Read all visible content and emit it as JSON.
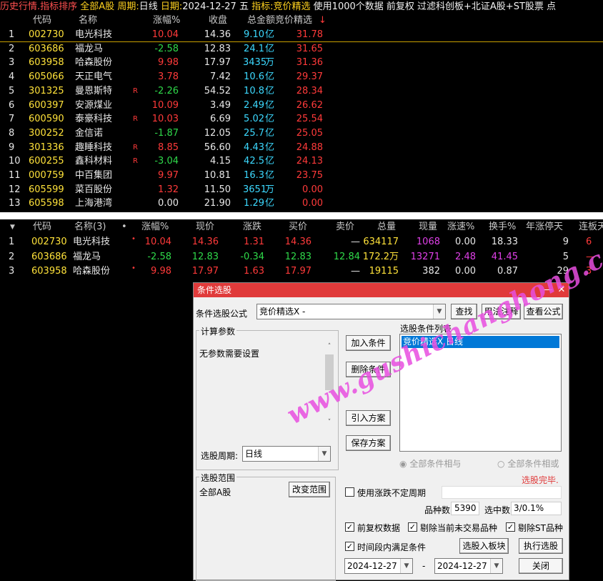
{
  "topbar": {
    "title": "历史行情.指标排序",
    "market": "全部A股",
    "period_label": "周期:",
    "period": "日线",
    "date_label": "日期:",
    "date": "2024-12-27",
    "weekday": "五",
    "indicator_label": "指标:",
    "indicator": "竞价精选",
    "note": "使用1000个数据 前复权 过滤科创板+北证A股+ST股票 点"
  },
  "table1": {
    "headers": {
      "code": "代码",
      "name": "名称",
      "pct": "涨幅%",
      "close": "收盘",
      "amount": "总金额",
      "score": "竞价精选",
      "sort": "↓"
    },
    "rows": [
      {
        "idx": "1",
        "code": "002730",
        "name": "电光科技",
        "flag": "",
        "pct": "10.04",
        "close": "14.36",
        "amount": "9.10",
        "unit": "亿",
        "score": "31.78",
        "pc": "red",
        "hl": true
      },
      {
        "idx": "2",
        "code": "603686",
        "name": "福龙马",
        "flag": "",
        "pct": "-2.58",
        "close": "12.83",
        "amount": "24.1",
        "unit": "亿",
        "score": "31.65",
        "pc": "grn"
      },
      {
        "idx": "3",
        "code": "603958",
        "name": "哈森股份",
        "flag": "",
        "pct": "9.98",
        "close": "17.97",
        "amount": "3435",
        "unit": "万",
        "score": "31.36",
        "pc": "red"
      },
      {
        "idx": "4",
        "code": "605066",
        "name": "天正电气",
        "flag": "",
        "pct": "3.78",
        "close": "7.42",
        "amount": "10.6",
        "unit": "亿",
        "score": "29.37",
        "pc": "red"
      },
      {
        "idx": "5",
        "code": "301325",
        "name": "曼恩斯特",
        "flag": "R",
        "pct": "-2.26",
        "close": "54.52",
        "amount": "10.8",
        "unit": "亿",
        "score": "28.34",
        "pc": "grn"
      },
      {
        "idx": "6",
        "code": "600397",
        "name": "安源煤业",
        "flag": "",
        "pct": "10.09",
        "close": "3.49",
        "amount": "2.49",
        "unit": "亿",
        "score": "26.62",
        "pc": "red"
      },
      {
        "idx": "7",
        "code": "600590",
        "name": "泰豪科技",
        "flag": "R",
        "pct": "10.03",
        "close": "6.69",
        "amount": "5.02",
        "unit": "亿",
        "score": "25.54",
        "pc": "red"
      },
      {
        "idx": "8",
        "code": "300252",
        "name": "金信诺",
        "flag": "",
        "pct": "-1.87",
        "close": "12.05",
        "amount": "25.7",
        "unit": "亿",
        "score": "25.05",
        "pc": "grn"
      },
      {
        "idx": "9",
        "code": "301336",
        "name": "趣睡科技",
        "flag": "R",
        "pct": "8.85",
        "close": "56.60",
        "amount": "4.43",
        "unit": "亿",
        "score": "24.88",
        "pc": "red"
      },
      {
        "idx": "10",
        "code": "600255",
        "name": "鑫科材料",
        "flag": "R",
        "pct": "-3.04",
        "close": "4.15",
        "amount": "42.5",
        "unit": "亿",
        "score": "24.13",
        "pc": "grn"
      },
      {
        "idx": "11",
        "code": "000759",
        "name": "中百集团",
        "flag": "",
        "pct": "9.97",
        "close": "10.81",
        "amount": "16.3",
        "unit": "亿",
        "score": "23.75",
        "pc": "red"
      },
      {
        "idx": "12",
        "code": "605599",
        "name": "菜百股份",
        "flag": "",
        "pct": "1.32",
        "close": "11.50",
        "amount": "3651",
        "unit": "万",
        "score": "0.00",
        "pc": "red"
      },
      {
        "idx": "13",
        "code": "605598",
        "name": "上海港湾",
        "flag": "",
        "pct": "0.00",
        "close": "21.90",
        "amount": "1.29",
        "unit": "亿",
        "score": "0.00",
        "pc": "wht"
      }
    ]
  },
  "table2": {
    "headers": {
      "sort": "▼",
      "code": "代码",
      "name": "名称(3)",
      "dot": "•",
      "pct": "涨幅%",
      "price": "现价",
      "chg": "涨跌",
      "bid": "买价",
      "ask": "卖价",
      "vol": "总量",
      "cur": "现量",
      "speed": "涨速%",
      "turn": "换手%",
      "days": "年涨停天",
      "lb": "连板天"
    },
    "rows": [
      {
        "idx": "1",
        "code": "002730",
        "name": "电光科技",
        "dot": "•",
        "pct": "10.04",
        "price": "14.36",
        "chg": "1.31",
        "bid": "14.36",
        "ask": "—",
        "vol": "634117",
        "cur": "1068",
        "speed": "0.00",
        "turn": "18.33",
        "days": "9",
        "lb": "6",
        "pc": "red",
        "sc": "wht",
        "tc": "wht",
        "curc": "mag"
      },
      {
        "idx": "2",
        "code": "603686",
        "name": "福龙马",
        "dot": "",
        "pct": "-2.58",
        "price": "12.83",
        "chg": "-0.34",
        "bid": "12.83",
        "ask": "12.84",
        "vol": "172.2万",
        "cur": "13271",
        "speed": "2.48",
        "turn": "41.45",
        "days": "5",
        "lb": "—",
        "pc": "grn",
        "sc": "mag",
        "tc": "mag",
        "curc": "mag"
      },
      {
        "idx": "3",
        "code": "603958",
        "name": "哈森股份",
        "dot": "•",
        "pct": "9.98",
        "price": "17.97",
        "chg": "1.63",
        "bid": "17.97",
        "ask": "—",
        "vol": "19115",
        "cur": "382",
        "speed": "0.00",
        "turn": "0.87",
        "days": "29",
        "lb": "3",
        "pc": "red",
        "sc": "wht",
        "tc": "wht",
        "curc": "wht"
      }
    ]
  },
  "dialog": {
    "title": "条件选股",
    "minimize": "—",
    "close": "✕",
    "formula_label": "条件选股公式",
    "formula_value": "竞价精选X  -",
    "find_btn": "查找",
    "usage_btn": "用法注释",
    "view_btn": "查看公式",
    "params_group": "计算参数",
    "params_text": "无参数需要设置",
    "add_btn": "加入条件",
    "del_btn": "删除条件",
    "import_btn": "引入方案",
    "save_btn": "保存方案",
    "list_label": "选股条件列表",
    "list_item": "竞价精选X  日线",
    "period_label": "选股周期:",
    "period_value": "日线",
    "radio_and": "全部条件相与",
    "radio_or": "全部条件相或",
    "status": "选股完毕.",
    "range_group": "选股范围",
    "range_value": "全部A股",
    "change_range_btn": "改变范围",
    "uncertain_label": "使用涨跌不定周期",
    "count_label": "品种数",
    "count_value": "5390",
    "selected_label": "选中数",
    "selected_value": "3/0.1%",
    "cb_fq": "前复权数据",
    "cb_untraded": "剔除当前未交易品种",
    "cb_st": "剔除ST品种",
    "cb_period": "时间段内满足条件",
    "to_block_btn": "选股入板块",
    "run_btn": "执行选股",
    "date_from": "2024-12-27",
    "date_sep": "-",
    "date_to": "2024-12-27",
    "close_btn": "关闭"
  },
  "watermark": "www.gushichanghong.com"
}
